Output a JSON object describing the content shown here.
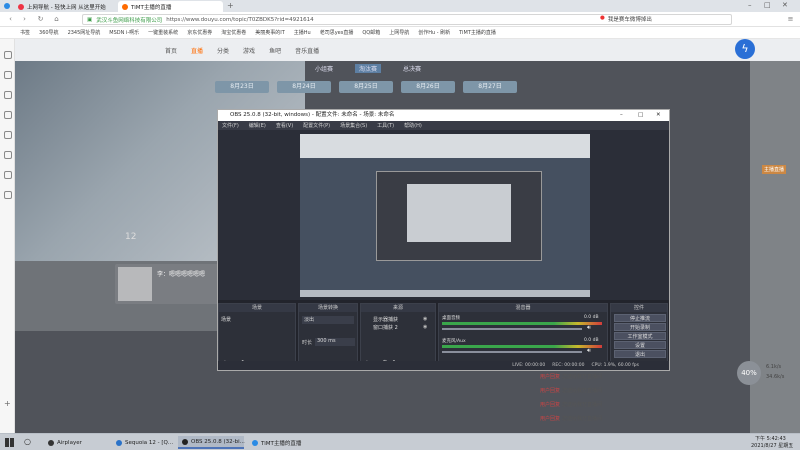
{
  "tabs": [
    {
      "label": "上网导航 - 轻快上网 从这里开始",
      "active": false
    },
    {
      "label": "TiMT主播的直播",
      "active": true
    }
  ],
  "addressbar": {
    "security_text": "武汉斗鱼网络科技有限公司",
    "url": "https://www.douyu.com/topic/T0ZBDK5?rid=4921614",
    "search_placeholder": "我是赛车微博掉出"
  },
  "bookmarks": [
    "书签",
    "360导航",
    "2345网址导航",
    "MSDN i-啊乐",
    "一键重装系统",
    "京东优惠券",
    "淘宝优惠卷",
    "美丽奥事的IT",
    "主播Hu",
    "老司思yes直播",
    "QQ邮箱",
    "上网导航",
    "创作Hu - 刷新",
    "TiMT主播的直播"
  ],
  "site": {
    "nav": [
      "首页",
      "直播",
      "分类",
      "游戏",
      "鱼吧",
      "音乐直播"
    ],
    "days": [
      "8月23日",
      "8月24日",
      "8月25日",
      "8月26日",
      "8月27日"
    ],
    "subtabs": [
      "小组赛",
      "淘汰赛",
      "总决赛"
    ],
    "live_count": "12",
    "streamer_name": "李：嗯嗯嗯嗯嗯嗯",
    "side_badge": "主播直播"
  },
  "obs": {
    "title": "OBS 25.0.8 (32-bit, windows) - 配置文件: 未命名 - 场景: 未命名",
    "menu": [
      "文件(F)",
      "编辑(E)",
      "查看(V)",
      "配置文件(P)",
      "场景集合(S)",
      "工具(T)",
      "帮助(H)"
    ],
    "docks": {
      "scenes": {
        "title": "场景",
        "items": [
          "场景"
        ]
      },
      "sources": {
        "title": "来源",
        "items": [
          "显示器捕获",
          "窗口捕获 2"
        ]
      },
      "transition": {
        "title": "场景转换",
        "mode": "淡出",
        "duration_label": "时长",
        "duration": "300 ms"
      },
      "mixer": {
        "title": "混音器",
        "channels": [
          {
            "name": "桌面音频",
            "db": "0.0 dB"
          },
          {
            "name": "麦克风/Aux",
            "db": "0.0 dB"
          }
        ]
      },
      "controls": {
        "title": "控件",
        "buttons": [
          "停止推流",
          "开始录制",
          "工作室模式",
          "设置",
          "退出"
        ]
      }
    },
    "status": {
      "live": "LIVE: 00:00:00",
      "rec": "REC: 00:00:00",
      "cpu": "CPU: 1.9%, 60.00 fps"
    }
  },
  "chat": [
    {
      "user": "用户回复",
      "text": "您送给我万直播间"
    },
    {
      "user": "用户回复",
      "text": "您送给我万直播间"
    },
    {
      "user": "用户回复",
      "text": "您送给我万直播间"
    },
    {
      "user": "用户回复",
      "text": "您送给我万直播间"
    }
  ],
  "side_stats": {
    "percent": "40%",
    "up": "6.1k/s",
    "down": "34.6k/s"
  },
  "taskbar": {
    "items": [
      {
        "label": "Airplayer"
      },
      {
        "label": "Sequoia 12 - [Q..."
      },
      {
        "label": "OBS 25.0.8 (32-bi...",
        "active": true
      },
      {
        "label": "TiMT主播的直播"
      }
    ],
    "time": "下午 5:42:43",
    "date": "2021/8/27 星期五"
  },
  "colors": {
    "accent": "#4e74b8",
    "brand": "#ff6b00"
  }
}
